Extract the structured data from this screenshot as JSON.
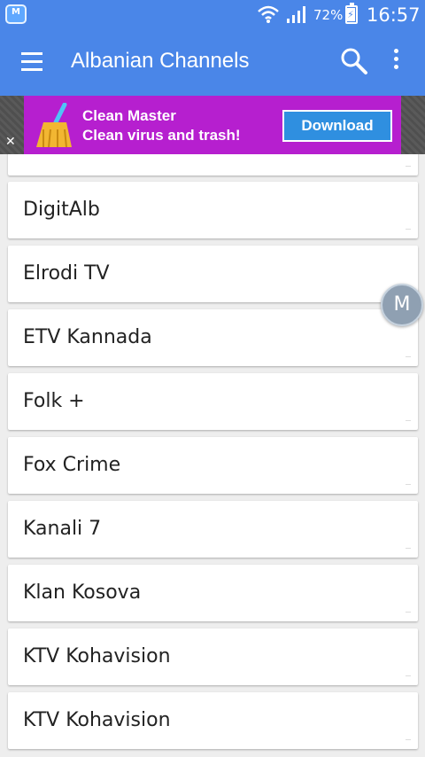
{
  "status_bar": {
    "battery_percent": "72%",
    "time": "16:57"
  },
  "app_bar": {
    "title": "Albanian Channels",
    "menu_icon": "hamburger-menu-icon",
    "search_icon": "search-icon",
    "more_icon": "overflow-menu-icon"
  },
  "ad": {
    "line1": "Clean Master",
    "line2": "Clean virus and trash!",
    "button": "Download",
    "close": "✕",
    "background": "#b61fcf"
  },
  "channels": [
    "DigitAlb",
    "Elrodi TV",
    "ETV Kannada",
    "Folk +",
    "Fox Crime",
    "Kanali 7",
    "Klan Kosova",
    "KTV Kohavision",
    "KTV Kohavision"
  ],
  "floating_button": {
    "label": "M"
  },
  "colors": {
    "primary": "#4a86e8",
    "background": "#eeeeee"
  }
}
